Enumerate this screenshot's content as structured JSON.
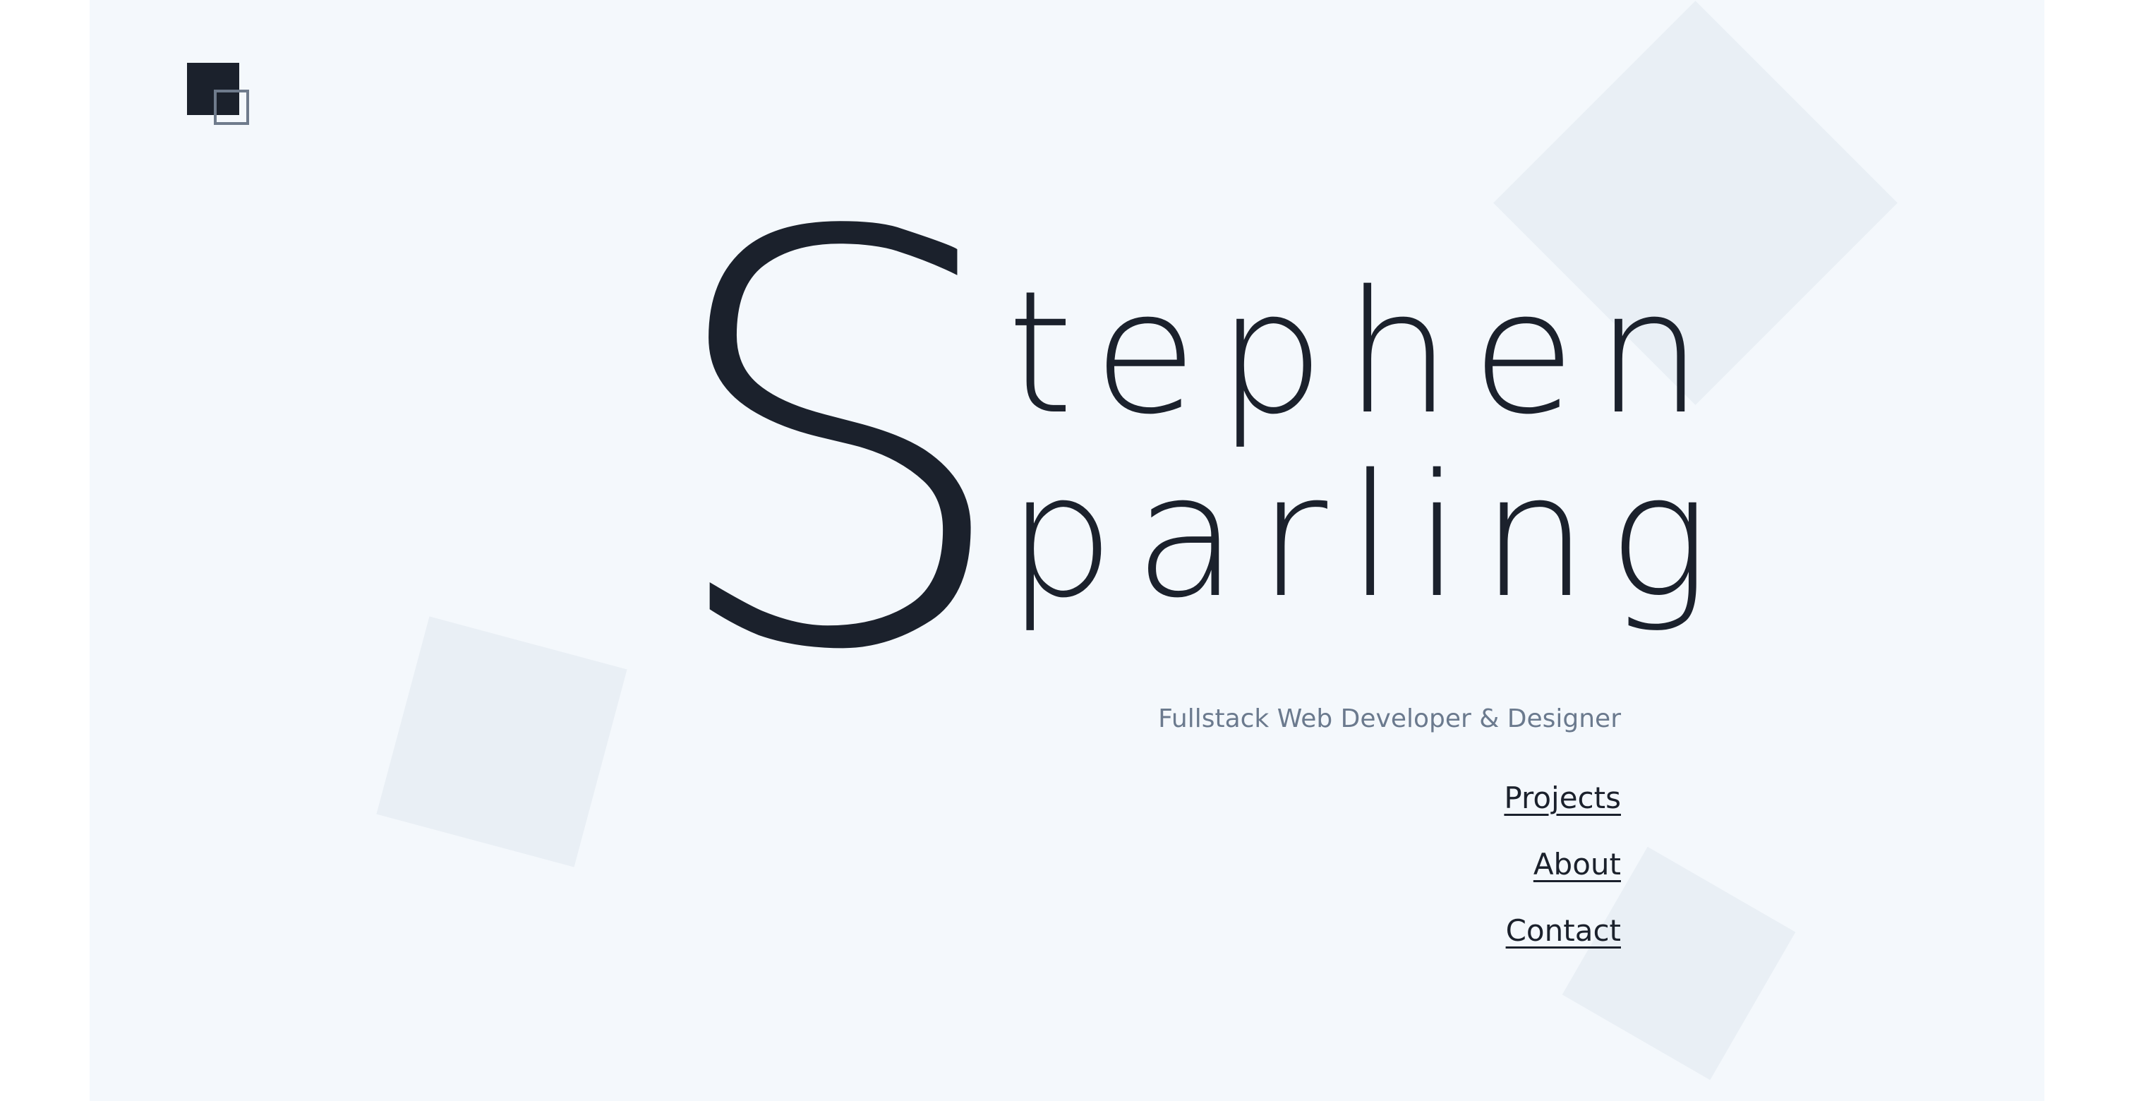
{
  "hero": {
    "initial": "S",
    "line_one": "tephen",
    "line_two": "parling"
  },
  "tagline": "Fullstack Web Developer & Designer",
  "nav": {
    "projects": "Projects",
    "about": "About",
    "contact": "Contact"
  },
  "colors": {
    "background": "#f4f8fc",
    "text": "#1b212c",
    "muted": "#6b7a8e",
    "decor": "#e9eff5"
  },
  "icons": {
    "logo": "overlapping-squares-logo-icon"
  }
}
